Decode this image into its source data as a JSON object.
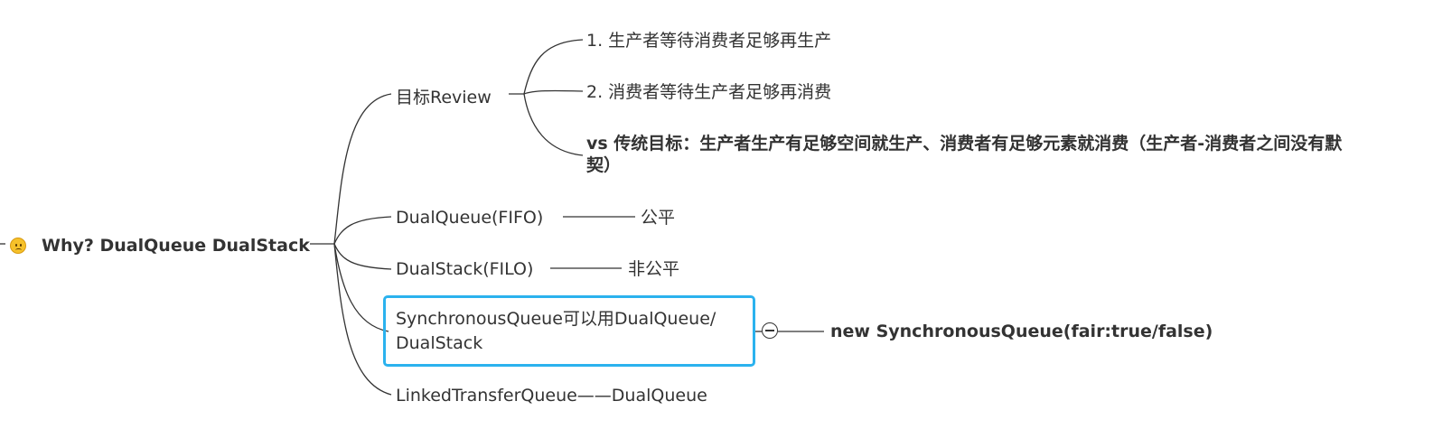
{
  "root": {
    "label": "Why? DualQueue DualStack",
    "icon": "confused-face-icon"
  },
  "branches": {
    "goal_review": {
      "label": "目标Review",
      "children": [
        "1. 生产者等待消费者足够再生产",
        "2. 消费者等待生产者足够再消费",
        "vs 传统目标：生产者生产有足够空间就生产、消费者有足够元素就消费（生产者-消费者之间没有默契）"
      ],
      "child3_line1": "vs 传统目标：生产者生产有足够空间就生产、消费者有足够元素就消费（生产者-消费者之间没有默",
      "child3_line2": "契）"
    },
    "dual_queue": {
      "label": "DualQueue(FIFO)",
      "child": "公平"
    },
    "dual_stack": {
      "label": "DualStack(FILO)",
      "child": "非公平"
    },
    "synchronous_queue": {
      "label": "SynchronousQueue可以用DualQueue/ DualStack",
      "line1": "SynchronousQueue可以用DualQueue/",
      "line2": "DualStack",
      "child": "new SynchronousQueue(fair:true/false)"
    },
    "linked_transfer_queue": {
      "label": "LinkedTransferQueue——DualQueue"
    }
  },
  "colors": {
    "line": "#333333",
    "selection": "#2bb2ee",
    "text": "#333333"
  }
}
